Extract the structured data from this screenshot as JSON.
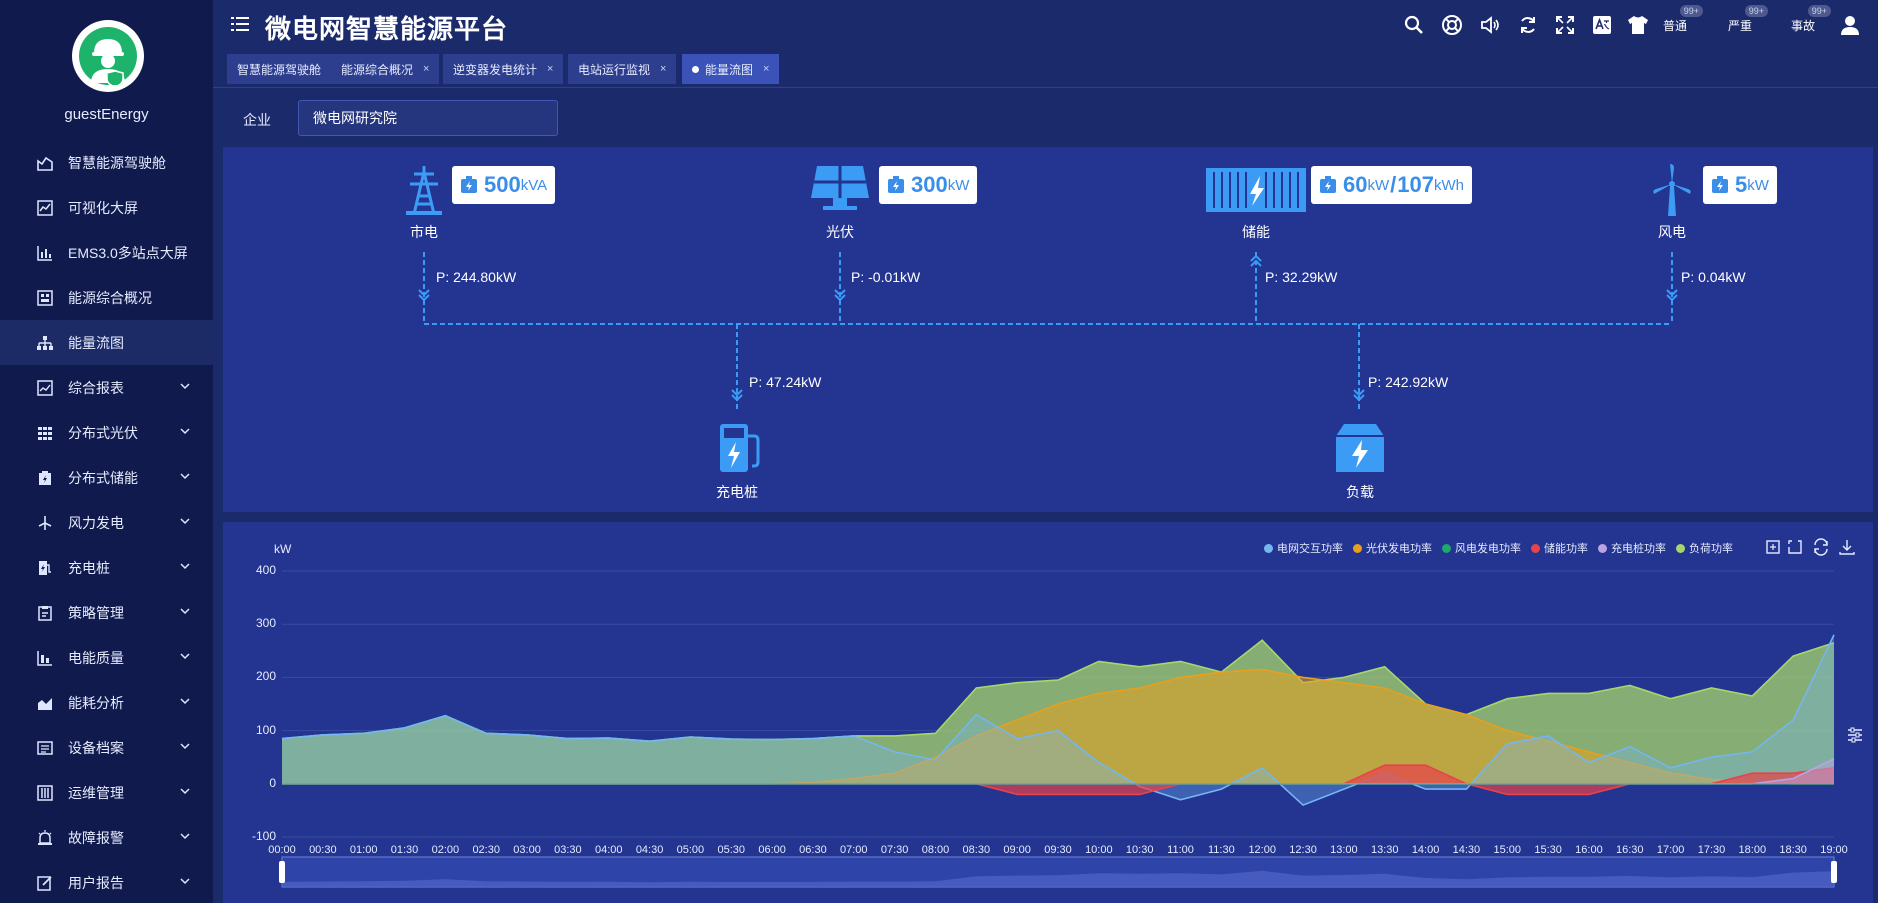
{
  "user": {
    "name": "guestEnergy"
  },
  "sidebar": {
    "items": [
      {
        "label": "智慧能源驾驶舱",
        "icon": "cockpit-icon",
        "expandable": false
      },
      {
        "label": "可视化大屏",
        "icon": "line-chart-icon",
        "expandable": false
      },
      {
        "label": "EMS3.0多站点大屏",
        "icon": "bar-chart-icon",
        "expandable": false
      },
      {
        "label": "能源综合概况",
        "icon": "dashboard-icon",
        "expandable": false
      },
      {
        "label": "能量流图",
        "icon": "flow-tree-icon",
        "expandable": false,
        "active": true
      },
      {
        "label": "综合报表",
        "icon": "report-icon",
        "expandable": true
      },
      {
        "label": "分布式光伏",
        "icon": "grid-icon",
        "expandable": true
      },
      {
        "label": "分布式储能",
        "icon": "storage-icon",
        "expandable": true
      },
      {
        "label": "风力发电",
        "icon": "wind-icon",
        "expandable": true
      },
      {
        "label": "充电桩",
        "icon": "charger-icon",
        "expandable": true
      },
      {
        "label": "策略管理",
        "icon": "strategy-icon",
        "expandable": true
      },
      {
        "label": "电能质量",
        "icon": "quality-icon",
        "expandable": true
      },
      {
        "label": "能耗分析",
        "icon": "analysis-icon",
        "expandable": true
      },
      {
        "label": "设备档案",
        "icon": "archive-icon",
        "expandable": true
      },
      {
        "label": "运维管理",
        "icon": "maintenance-icon",
        "expandable": true
      },
      {
        "label": "故障报警",
        "icon": "alarm-icon",
        "expandable": true
      },
      {
        "label": "用户报告",
        "icon": "user-report-icon",
        "expandable": true
      }
    ]
  },
  "header": {
    "title": "微电网智慧能源平台",
    "status": [
      {
        "label": "普通",
        "count": "99+",
        "color": "#1fb36b"
      },
      {
        "label": "严重",
        "count": "99+",
        "color": "#f0a81c"
      },
      {
        "label": "事故",
        "count": "99+",
        "color": "#e8424a"
      }
    ]
  },
  "tabs": [
    {
      "label": "智慧能源驾驶舱",
      "closable": false
    },
    {
      "label": "能源综合概况",
      "closable": true
    },
    {
      "label": "逆变器发电统计",
      "closable": true
    },
    {
      "label": "电站运行监视",
      "closable": true
    },
    {
      "label": "能量流图",
      "closable": true,
      "active": true
    }
  ],
  "filter": {
    "label": "企业",
    "value": "微电网研究院"
  },
  "flow": {
    "sources": [
      {
        "name": "市电",
        "capacity": "500",
        "unit": "kVA",
        "power": "P: 244.80kW",
        "direction": "down"
      },
      {
        "name": "光伏",
        "capacity": "300",
        "unit": "kW",
        "power": "P: -0.01kW",
        "direction": "down"
      },
      {
        "name": "储能",
        "capacity": "60",
        "unit": "kW",
        "capacity2": "107",
        "unit2": "kWh",
        "power": "P: 32.29kW",
        "direction": "up"
      },
      {
        "name": "风电",
        "capacity": "5",
        "unit": "kW",
        "power": "P: 0.04kW",
        "direction": "down"
      }
    ],
    "loads": [
      {
        "name": "充电桩",
        "power": "P: 47.24kW"
      },
      {
        "name": "负载",
        "power": "P: 242.92kW"
      }
    ]
  },
  "chart_data": {
    "type": "area",
    "ylabel": "kW",
    "ylim": [
      -100,
      400
    ],
    "yticks": [
      400,
      300,
      200,
      100,
      0,
      -100
    ],
    "x_labels": [
      "00:00",
      "00:30",
      "01:00",
      "01:30",
      "02:00",
      "02:30",
      "03:00",
      "03:30",
      "04:00",
      "04:30",
      "05:00",
      "05:30",
      "06:00",
      "06:30",
      "07:00",
      "07:30",
      "08:00",
      "08:30",
      "09:00",
      "09:30",
      "10:00",
      "10:30",
      "11:00",
      "11:30",
      "12:00",
      "12:30",
      "13:00",
      "13:30",
      "14:00",
      "14:30",
      "15:00",
      "15:30",
      "16:00",
      "16:30",
      "17:00",
      "17:30",
      "18:00",
      "18:30",
      "19:00"
    ],
    "legend_position": "top-right",
    "series": [
      {
        "name": "电网交互功率",
        "color": "#73b6f0",
        "values": [
          85,
          92,
          95,
          105,
          128,
          95,
          92,
          85,
          86,
          80,
          88,
          84,
          83,
          85,
          90,
          60,
          45,
          130,
          85,
          100,
          40,
          -5,
          -30,
          -10,
          30,
          -40,
          -10,
          20,
          -10,
          -10,
          75,
          90,
          40,
          70,
          30,
          50,
          60,
          120,
          280
        ]
      },
      {
        "name": "光伏发电功率",
        "color": "#e8a01c",
        "values": [
          0,
          0,
          0,
          0,
          0,
          0,
          0,
          0,
          0,
          0,
          0,
          0,
          0,
          2,
          10,
          20,
          50,
          90,
          120,
          150,
          170,
          180,
          200,
          210,
          215,
          200,
          190,
          180,
          150,
          130,
          100,
          80,
          60,
          40,
          20,
          8,
          2,
          0,
          0
        ]
      },
      {
        "name": "风电发电功率",
        "color": "#1fa86a",
        "values": [
          0,
          0,
          0,
          0,
          0,
          0,
          0,
          0,
          0,
          0,
          0,
          0,
          0,
          0,
          0,
          0,
          0,
          0,
          0,
          0,
          0,
          0,
          0,
          0,
          0,
          0,
          0,
          0,
          0,
          0,
          0,
          0,
          0,
          0,
          0,
          0,
          0,
          0,
          0
        ]
      },
      {
        "name": "储能功率",
        "color": "#e8424a",
        "values": [
          0,
          0,
          0,
          0,
          0,
          0,
          0,
          0,
          0,
          0,
          0,
          0,
          0,
          0,
          0,
          0,
          0,
          0,
          -20,
          -20,
          -20,
          -20,
          0,
          0,
          0,
          0,
          0,
          35,
          35,
          0,
          -20,
          -20,
          -20,
          0,
          0,
          0,
          20,
          20,
          30
        ]
      },
      {
        "name": "充电桩功率",
        "color": "#b9a3e3",
        "values": [
          0,
          0,
          0,
          0,
          0,
          0,
          0,
          0,
          0,
          0,
          0,
          0,
          0,
          0,
          0,
          0,
          0,
          0,
          0,
          0,
          0,
          0,
          0,
          0,
          0,
          0,
          0,
          0,
          0,
          0,
          0,
          0,
          0,
          0,
          0,
          0,
          0,
          10,
          47
        ]
      },
      {
        "name": "负荷功率",
        "color": "#a8d66a",
        "values": [
          85,
          92,
          95,
          105,
          128,
          95,
          92,
          85,
          86,
          80,
          88,
          84,
          83,
          85,
          90,
          90,
          95,
          180,
          190,
          195,
          230,
          220,
          230,
          210,
          270,
          190,
          200,
          220,
          150,
          130,
          160,
          170,
          170,
          185,
          160,
          180,
          165,
          240,
          265
        ]
      }
    ]
  }
}
